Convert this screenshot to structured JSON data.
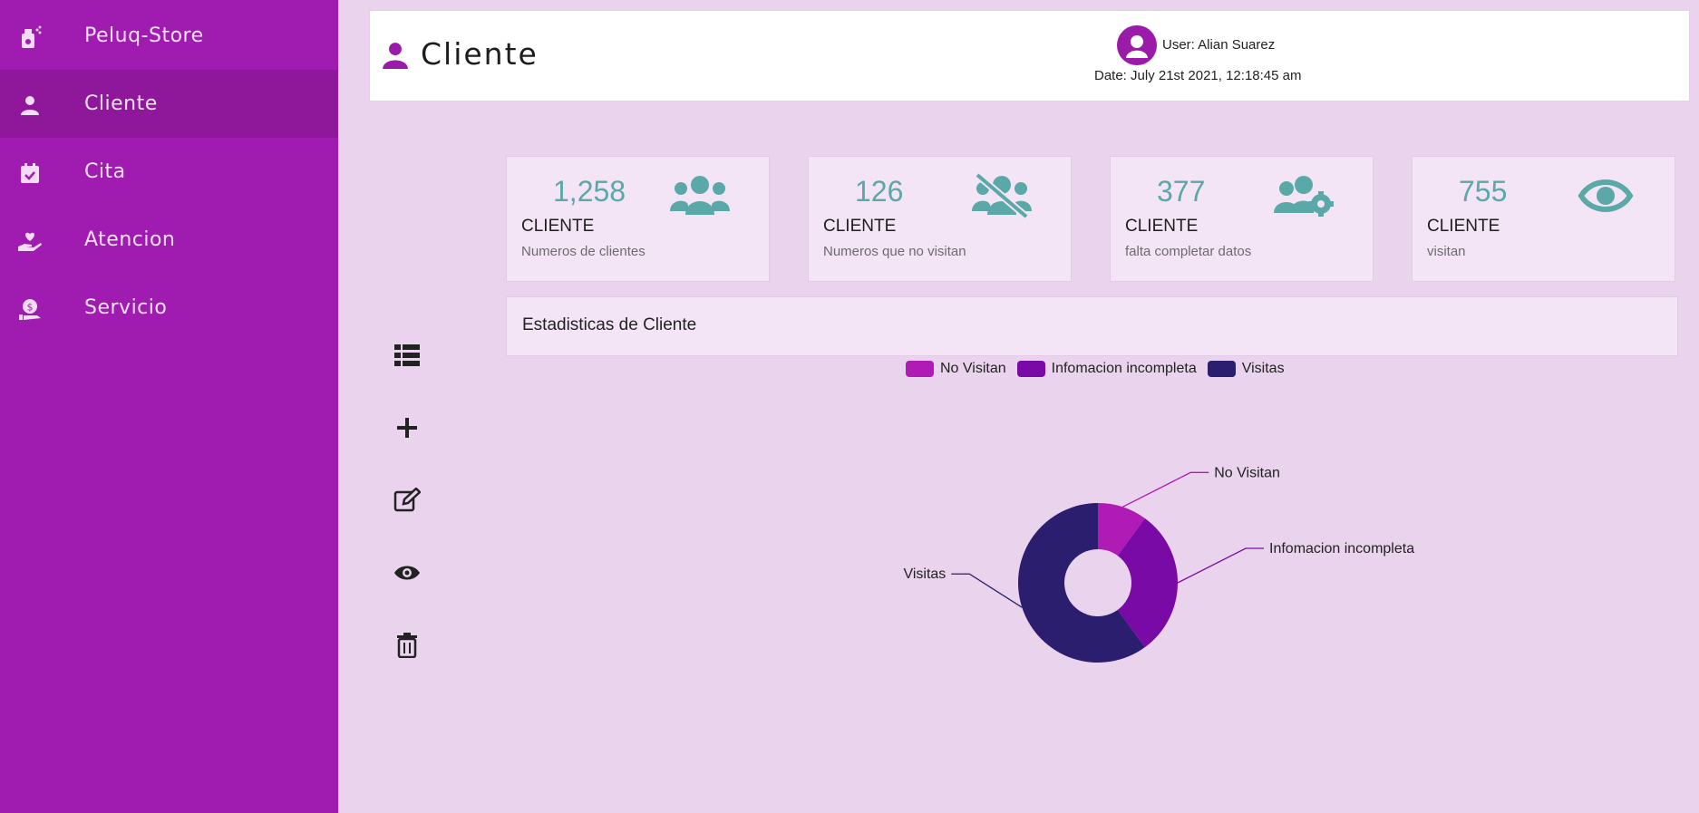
{
  "sidebar": {
    "brand": "Peluq-Store",
    "items": [
      {
        "label": "Cliente",
        "icon": "user-icon",
        "active": true
      },
      {
        "label": "Cita",
        "icon": "calendar-check-icon"
      },
      {
        "label": "Atencion",
        "icon": "hand-holding-heart-icon"
      },
      {
        "label": "Servicio",
        "icon": "money-hand-icon"
      }
    ]
  },
  "header": {
    "title": "Cliente",
    "user": "User: Alian Suarez",
    "date": "Date: July 21st 2021, 12:18:45 am"
  },
  "actions": [
    "list-icon",
    "plus-icon",
    "edit-icon",
    "eye-icon",
    "trash-icon"
  ],
  "cards": [
    {
      "value": "1,258",
      "caption": "CLIENTE",
      "sub": "Numeros de clientes",
      "icon": "users-icon"
    },
    {
      "value": "126",
      "caption": "CLIENTE",
      "sub": "Numeros que no visitan",
      "icon": "users-slash-icon"
    },
    {
      "value": "377",
      "caption": "CLIENTE",
      "sub": "falta completar datos",
      "icon": "users-cog-icon"
    },
    {
      "value": "755",
      "caption": "CLIENTE",
      "sub": "visitan",
      "icon": "eye-icon"
    }
  ],
  "stats_title": "Estadisticas de Cliente",
  "colors": {
    "sidebar": "#a01bb0",
    "accent": "#9a1aa9",
    "teal": "#5aa8a8",
    "no_visitan": "#b01ab5",
    "incompleta": "#7a0aa6",
    "visitas": "#2b1e6e"
  },
  "chart_data": {
    "type": "pie",
    "donut": true,
    "legend": "top",
    "categories": [
      "No Visitan",
      "Infomacion incompleta",
      "Visitas"
    ],
    "values": [
      126,
      377,
      755
    ]
  }
}
